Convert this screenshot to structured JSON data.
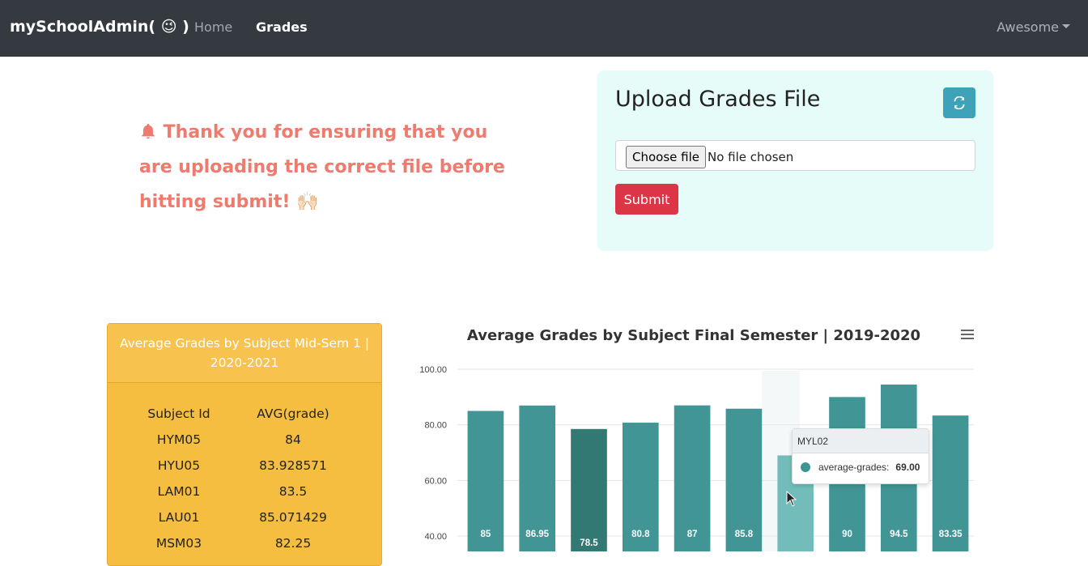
{
  "nav": {
    "brand": "mySchoolAdmin( 😉 )",
    "home": "Home",
    "grades": "Grades",
    "user_menu": "Awesome"
  },
  "notice": {
    "text": "Thank you for ensuring that you are uploading the correct file before hitting submit! 🙌🏻"
  },
  "upload": {
    "title": "Upload Grades File",
    "choose_label": "Choose file",
    "no_file": "No file chosen",
    "submit_label": "Submit"
  },
  "grades_card": {
    "title": "Average Grades by Subject Mid-Sem 1 | 2020-2021",
    "headers": [
      "Subject Id",
      "AVG(grade)"
    ],
    "rows": [
      [
        "HYM05",
        "84"
      ],
      [
        "HYU05",
        "83.928571"
      ],
      [
        "LAM01",
        "83.5"
      ],
      [
        "LAU01",
        "85.071429"
      ],
      [
        "MSM03",
        "82.25"
      ]
    ]
  },
  "chart_data": {
    "type": "bar",
    "title": "Average Grades by Subject Final Semester | 2019-2020",
    "y_ticks": [
      "100.00",
      "80.00",
      "60.00",
      "40.00"
    ],
    "ylim": [
      40,
      100
    ],
    "values": [
      85,
      86.95,
      78.5,
      80.8,
      87,
      85.8,
      69,
      90,
      94.5,
      83.35
    ],
    "value_labels": [
      "85",
      "86.95",
      "78.5",
      "80.8",
      "87",
      "85.8",
      "",
      "90",
      "94.5",
      "83.35"
    ],
    "series_name": "average-grades",
    "bar_color": "#3e9393",
    "hover_index": 6
  },
  "tooltip": {
    "category": "MYL02",
    "series": "average-grades:",
    "value": "69.00"
  },
  "colors": {
    "navbar": "#343a40",
    "notice": "#ee7b6e",
    "upload_bg": "#e6fcf8",
    "refresh": "#3ea2b8",
    "submit": "#dc3545",
    "grades_card": "#f6be41"
  }
}
